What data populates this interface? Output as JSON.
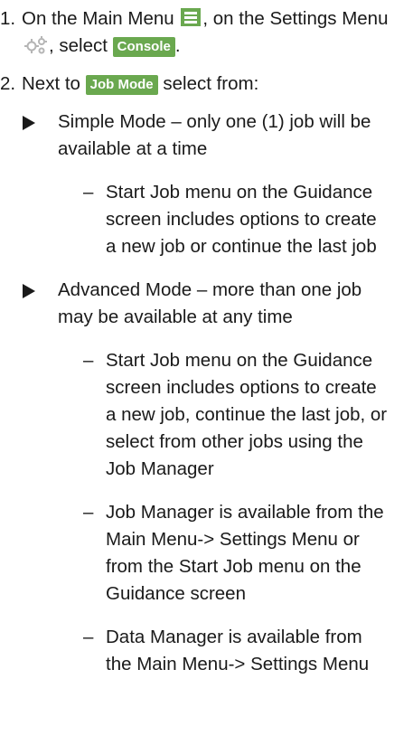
{
  "step1": {
    "num": "1.",
    "text_a": "On the Main Menu",
    "text_b": ", on the Settings Menu",
    "text_c": ", select",
    "text_d": ".",
    "chip": "Console",
    "icons": [
      "menu-icon",
      "gear-icon"
    ],
    "accent_color": "#6aa84f"
  },
  "step2": {
    "num": "2.",
    "text_a": "Next to",
    "chip": "Job Mode",
    "text_b": "select from:"
  },
  "simple": {
    "text": "Simple Mode – only one (1) job will be available at a time",
    "sub": [
      "Start Job menu on the Guidance screen includes options to create a new job or continue the last job"
    ]
  },
  "advanced": {
    "text": "Advanced Mode – more than one job may be available at any time",
    "sub": [
      "Start Job menu on the Guidance screen includes options to create a new job, continue the last job, or select from other jobs using the Job Manager",
      "Job Manager is available from the Main Menu-> Settings Menu or from the Start Job menu on the Guidance screen",
      "Data Manager is available from the Main Menu-> Settings Menu"
    ]
  },
  "dash_char": "–"
}
